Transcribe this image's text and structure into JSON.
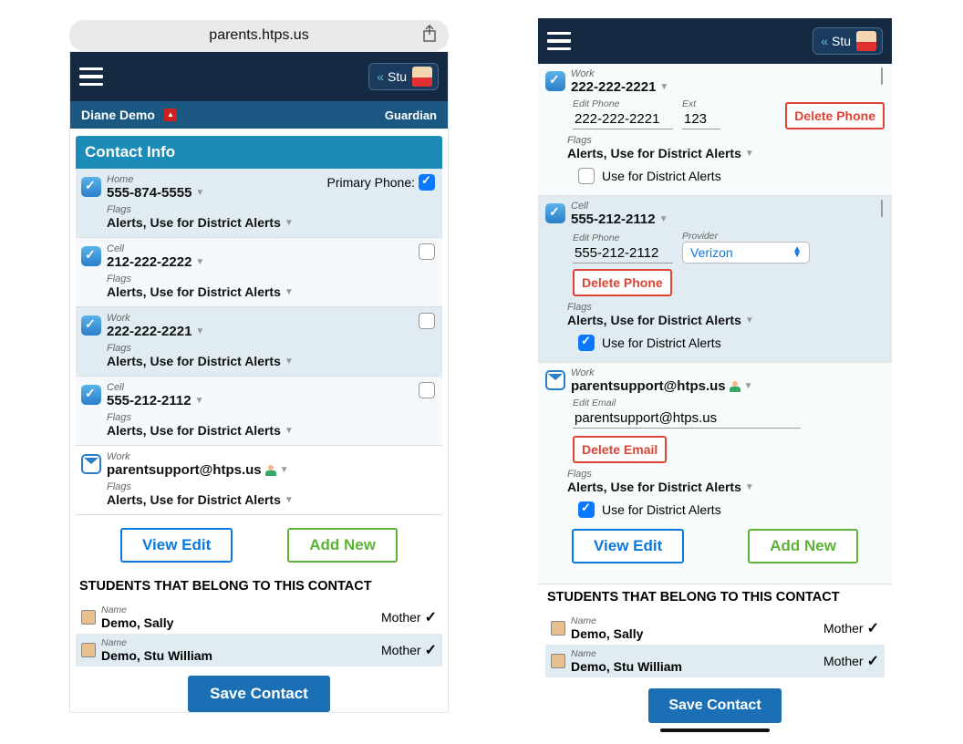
{
  "address_url": "parents.htps.us",
  "nav": {
    "stu": "Stu",
    "chev": "«"
  },
  "left": {
    "contact_name": "Diane Demo",
    "role": "Guardian",
    "section_title": "Contact Info",
    "primary_phone_label": "Primary Phone:",
    "flags_label": "Flags",
    "flags_text": "Alerts, Use for District Alerts",
    "rows": [
      {
        "type_label": "Home",
        "value": "555-874-5555",
        "icon": "phone",
        "primary": true
      },
      {
        "type_label": "Cell",
        "value": "212-222-2222",
        "icon": "phone"
      },
      {
        "type_label": "Work",
        "value": "222-222-2221",
        "icon": "phone"
      },
      {
        "type_label": "Cell",
        "value": "555-212-2112",
        "icon": "phone"
      },
      {
        "type_label": "Work",
        "value": "parentsupport@htps.us",
        "icon": "email"
      }
    ],
    "view_edit": "View Edit",
    "add_new": "Add New",
    "students_header": "STUDENTS THAT BELONG TO THIS CONTACT",
    "name_label": "Name",
    "students": [
      {
        "name": "Demo, Sally",
        "relation": "Mother"
      },
      {
        "name": "Demo, Stu William",
        "relation": "Mother"
      }
    ],
    "save": "Save Contact"
  },
  "right": {
    "flags_label": "Flags",
    "flags_text": "Alerts, Use for District Alerts",
    "use_district": "Use for District Alerts",
    "edit_phone_label": "Edit Phone",
    "ext_label": "Ext",
    "provider_label": "Provider",
    "edit_email_label": "Edit Email",
    "delete_phone": "Delete Phone",
    "delete_email": "Delete Email",
    "sections": {
      "work_phone": {
        "type": "Work",
        "value": "222-222-2221",
        "edit": "222-222-2221",
        "ext": "123"
      },
      "cell_phone": {
        "type": "Cell",
        "value": "555-212-2112",
        "edit": "555-212-2112",
        "provider": "Verizon"
      },
      "work_email": {
        "type": "Work",
        "value": "parentsupport@htps.us",
        "edit": "parentsupport@htps.us"
      }
    },
    "view_edit": "View Edit",
    "add_new": "Add New",
    "students_header": "STUDENTS THAT BELONG TO THIS CONTACT",
    "name_label": "Name",
    "students": [
      {
        "name": "Demo, Sally",
        "relation": "Mother"
      },
      {
        "name": "Demo, Stu William",
        "relation": "Mother"
      }
    ],
    "save": "Save Contact"
  }
}
